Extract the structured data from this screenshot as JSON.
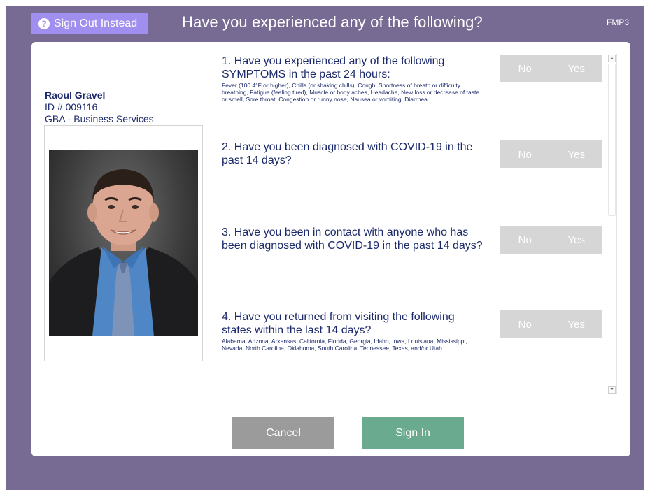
{
  "header": {
    "sign_out_label": "Sign Out Instead",
    "title": "Have you experienced any of the following?",
    "station_code": "FMP3"
  },
  "person": {
    "name": "Raoul Gravel",
    "id_line": "ID # 009116",
    "department": "GBA - Business Services"
  },
  "questions": [
    {
      "title": "1. Have you experienced any of the following SYMPTOMS in the past 24 hours:",
      "detail": "Fever (100.4°F or higher), Chills (or shaking chills), Cough, Shortness of breath or difficulty breathing, Fatigue (feeling tired), Muscle or body aches, Headache, New loss or decrease of taste or smell, Sore throat, Congestion or runny nose, Nausea or vomiting, Diarrhea.",
      "no": "No",
      "yes": "Yes"
    },
    {
      "title": "2. Have you been diagnosed with COVID-19 in the past 14 days?",
      "detail": "",
      "no": "No",
      "yes": "Yes"
    },
    {
      "title": "3. Have you been in contact with anyone who has been diagnosed with COVID-19 in the past 14 days?",
      "detail": "",
      "no": "No",
      "yes": "Yes"
    },
    {
      "title": "4. Have you returned from visiting the following states within the last 14 days?",
      "detail": "Alabama, Arizona, Arkansas, California, Florida, Georgia, Idaho, Iowa, Louisiana, Mississippi, Nevada, North Carolina, Oklahoma, South Carolina, Tennessee, Texas, and/or Utah",
      "no": "No",
      "yes": "Yes"
    }
  ],
  "footer": {
    "cancel_label": "Cancel",
    "sign_in_label": "Sign In"
  },
  "colors": {
    "background": "#776a93",
    "sign_out_button": "#a18ff0",
    "text": "#1c2a6b",
    "toggle_inactive": "#d6d6d6",
    "cancel_button": "#9b9b9b",
    "sign_in_button": "#6aaa8e"
  },
  "icons": {
    "sign_out": "question-circle-icon",
    "scroll_up": "chevron-up-icon",
    "scroll_down": "chevron-down-icon"
  }
}
